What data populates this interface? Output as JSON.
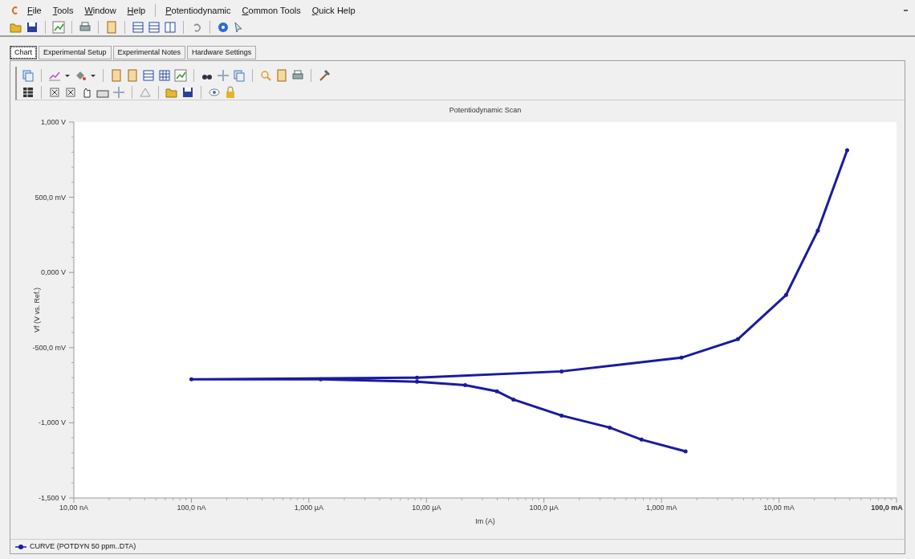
{
  "menu": [
    {
      "label": "File"
    },
    {
      "label": "Tools"
    },
    {
      "label": "Window"
    },
    {
      "label": "Help"
    },
    {
      "label": "Potentiodynamic",
      "group_start": true
    },
    {
      "label": "Common Tools"
    },
    {
      "label": "Quick Help"
    }
  ],
  "tabs": [
    {
      "label": "Chart",
      "selected": true
    },
    {
      "label": "Experimental Setup",
      "selected": false
    },
    {
      "label": "Experimental Notes",
      "selected": false
    },
    {
      "label": "Hardware Settings",
      "selected": false
    }
  ],
  "chart": {
    "title": "Potentiodynamic Scan",
    "xlabel": "Im (A)",
    "ylabel": "Vf (V vs. Ref.)",
    "xticks": [
      "10,00 nA",
      "100,0 nA",
      "1,000 µA",
      "10,00 µA",
      "100,0 µA",
      "1,000 mA",
      "10,00 mA",
      "100,0 mA"
    ],
    "yticks": [
      "1,000 V",
      "500,0 mV",
      "0,000 V",
      "-500,0 mV",
      "-1,000 V",
      "-1,500 V"
    ]
  },
  "legend": [
    {
      "label": "CURVE (POTDYN 50 ppm..DTA)",
      "color": "#1a1aa0"
    }
  ]
}
